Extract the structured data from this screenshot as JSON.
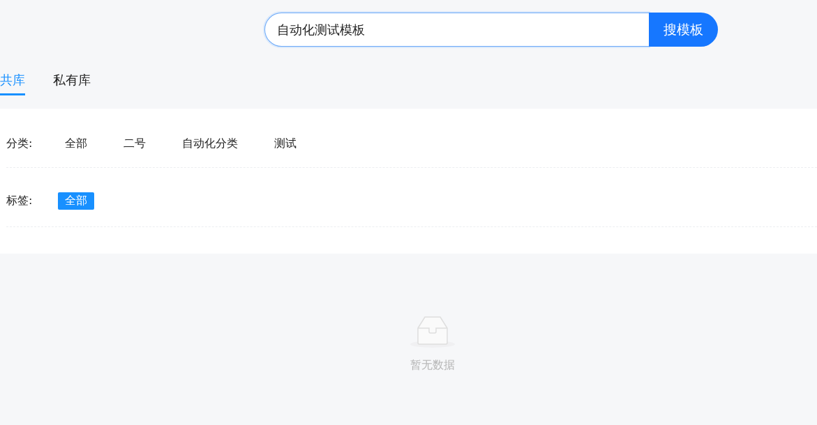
{
  "search": {
    "value": "自动化测试模板",
    "button": "搜模板"
  },
  "tabs": [
    {
      "label": "共库",
      "selected": true
    },
    {
      "label": "私有库",
      "selected": false
    }
  ],
  "filters": [
    {
      "label": "分类:",
      "options": [
        {
          "label": "全部",
          "selected": false
        },
        {
          "label": "二号",
          "selected": false
        },
        {
          "label": "自动化分类",
          "selected": false
        },
        {
          "label": "测试",
          "selected": false
        }
      ]
    },
    {
      "label": "标签:",
      "options": [
        {
          "label": "全部",
          "selected": true
        }
      ]
    }
  ],
  "empty": {
    "text": "暂无数据"
  }
}
